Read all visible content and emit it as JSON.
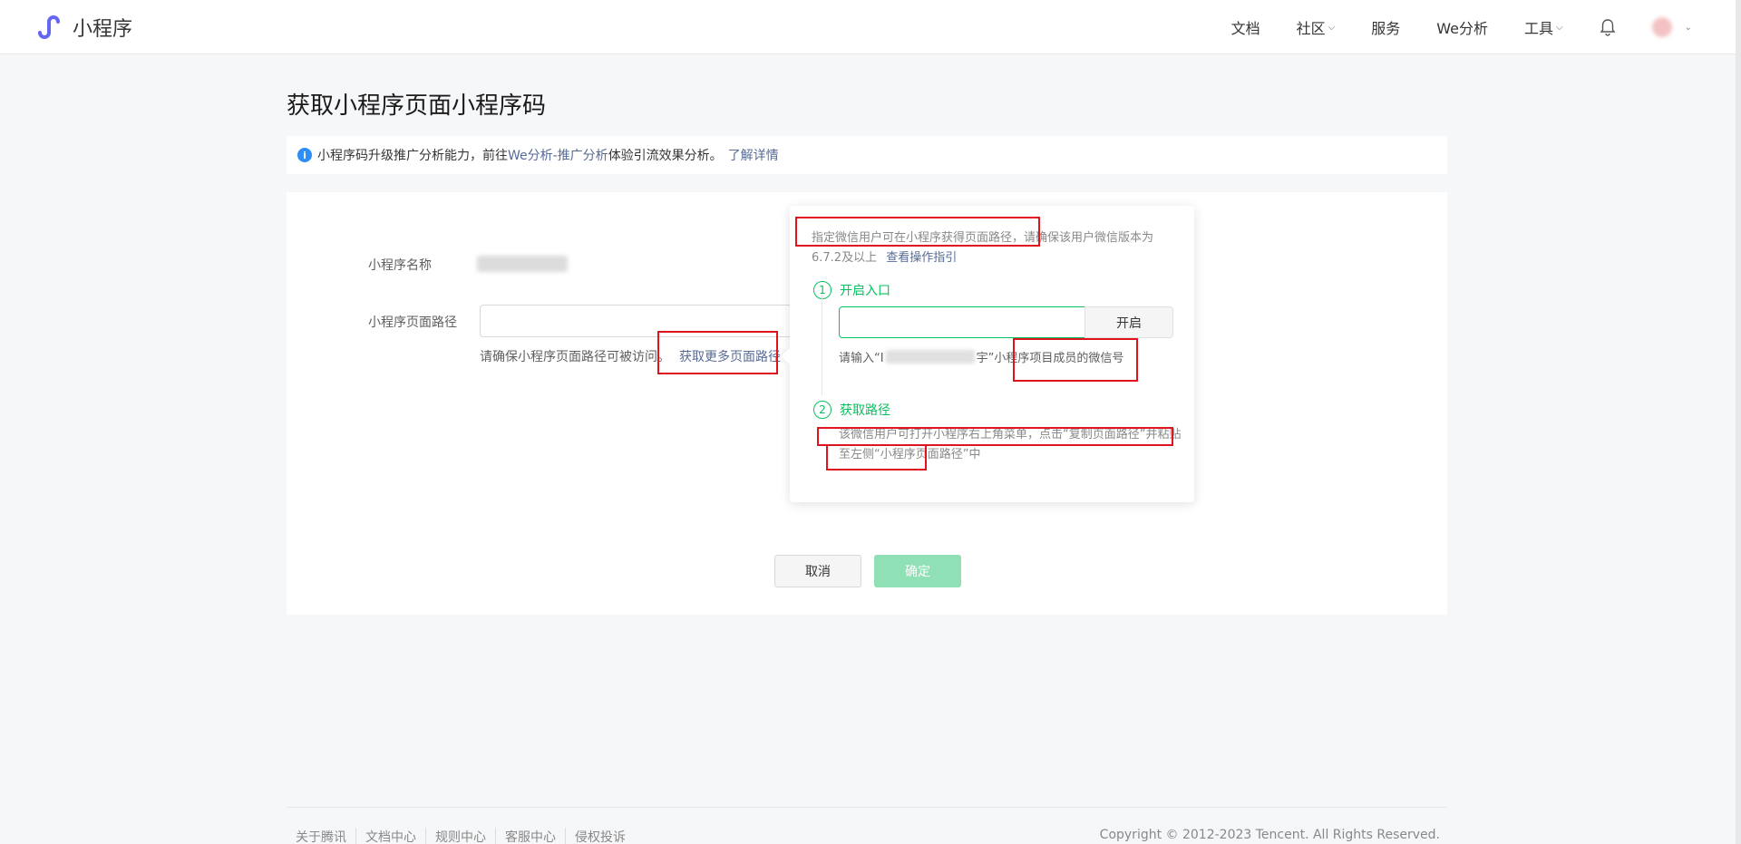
{
  "header": {
    "logo_text": "小程序",
    "nav": [
      {
        "label": "文档",
        "dropdown": false
      },
      {
        "label": "社区",
        "dropdown": true
      },
      {
        "label": "服务",
        "dropdown": false
      },
      {
        "label": "We分析",
        "dropdown": false
      },
      {
        "label": "工具",
        "dropdown": true
      }
    ],
    "chevron": "⌵",
    "avatar_chevron": "⌄"
  },
  "page": {
    "title": "获取小程序页面小程序码"
  },
  "notice": {
    "icon": "i",
    "text_before": "小程序码升级推广分析能力，前往",
    "link_analysis": "We分析-推广分析",
    "text_after": "体验引流效果分析。",
    "link_more": "了解详情"
  },
  "form": {
    "name_label": "小程序名称",
    "path_label": "小程序页面路径",
    "path_value": "",
    "path_hint": "请确保小程序页面路径可被访问。",
    "path_link": "获取更多页面路径",
    "cancel_label": "取消",
    "ok_label": "确定"
  },
  "popover": {
    "desc": "指定微信用户可在小程序获得页面路径，请确保该用户微信版本为6.7.2及以上",
    "guide_link": "查看操作指引",
    "step1_num": "1",
    "step1_title": "开启入口",
    "wechat_input_value": "",
    "open_label": "开启",
    "hint_before": "请输入“I",
    "hint_after": "宇”小程序项目成员的微信号",
    "step2_num": "2",
    "step2_title": "获取路径",
    "step2_text": "该微信用户可打开小程序右上角菜单，点击“复制页面路径”并粘贴至左侧“小程序页面路径”中"
  },
  "footer": {
    "links": [
      "关于腾讯",
      "文档中心",
      "规则中心",
      "客服中心",
      "侵权投诉"
    ],
    "copyright": "Copyright © 2012-2023 Tencent. All Rights Reserved."
  },
  "colors": {
    "accent_green": "#07c160",
    "link_blue": "#576b95",
    "annotation_red": "#e0141e",
    "logo_purple": "#6467f0"
  }
}
